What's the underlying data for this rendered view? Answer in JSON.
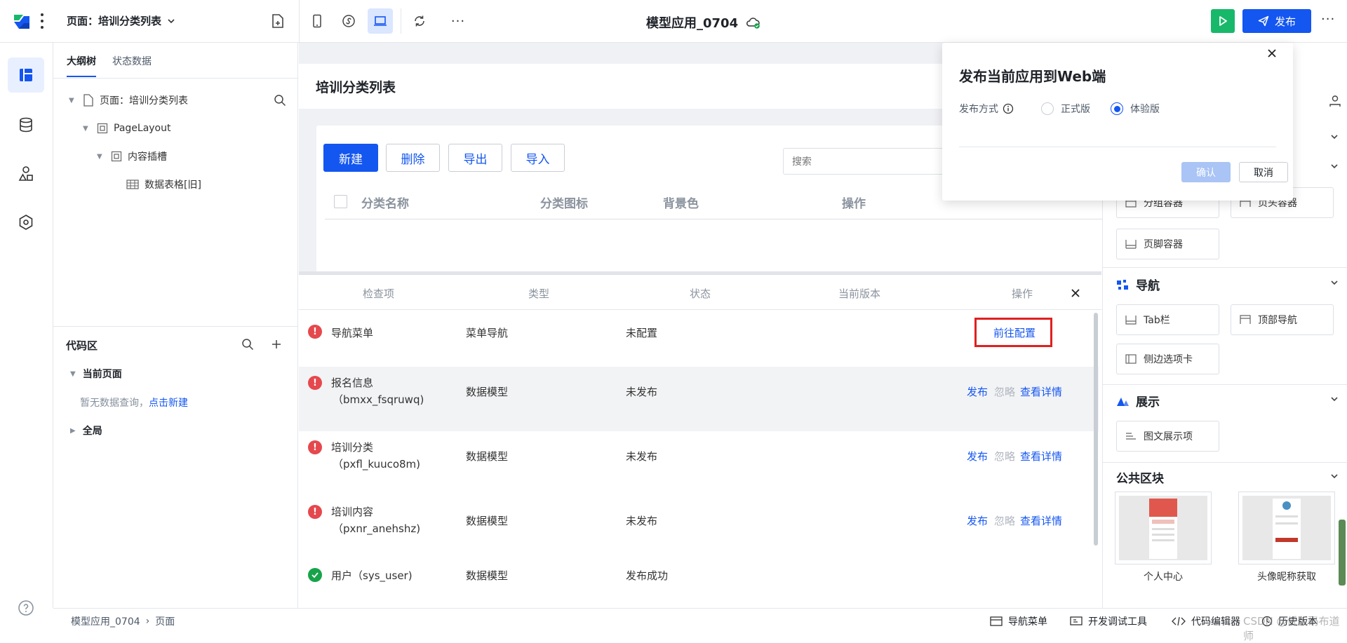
{
  "topbar": {
    "page_selector": "页面：培训分类列表",
    "app_title": "模型应用_0704",
    "publish_label": "发布"
  },
  "left_panel": {
    "tabs": [
      "大纲树",
      "状态数据"
    ],
    "tree": [
      {
        "label": "页面：培训分类列表"
      },
      {
        "label": "PageLayout"
      },
      {
        "label": "内容插槽"
      },
      {
        "label": "数据表格[旧]"
      }
    ],
    "code_area": {
      "title": "代码区",
      "current_page": "当前页面",
      "empty_text": "暂无数据查询，",
      "create_link": "点击新建",
      "global": "全局"
    }
  },
  "canvas": {
    "page_title": "培训分类列表",
    "buttons": {
      "new": "新建",
      "delete": "删除",
      "export": "导出",
      "import": "导入"
    },
    "search_placeholder": "搜索",
    "columns": [
      "分类名称",
      "分类图标",
      "背景色",
      "操作"
    ]
  },
  "check_panel": {
    "columns": [
      "检查项",
      "类型",
      "状态",
      "当前版本",
      "操作"
    ],
    "rows": [
      {
        "status_icon": "error",
        "name": "导航菜单",
        "code": "",
        "type": "菜单导航",
        "state": "未配置",
        "actions": {
          "goto": "前往配置"
        }
      },
      {
        "status_icon": "error",
        "name": "报名信息",
        "code": "（bmxx_fsqruwq)",
        "type": "数据模型",
        "state": "未发布",
        "actions": {
          "publish": "发布",
          "ignore": "忽略",
          "detail": "查看详情"
        }
      },
      {
        "status_icon": "error",
        "name": "培训分类",
        "code": "（pxfl_kuuco8m)",
        "type": "数据模型",
        "state": "未发布",
        "actions": {
          "publish": "发布",
          "ignore": "忽略",
          "detail": "查看详情"
        }
      },
      {
        "status_icon": "error",
        "name": "培训内容",
        "code": "（pxnr_anehshz)",
        "type": "数据模型",
        "state": "未发布",
        "actions": {
          "publish": "发布",
          "ignore": "忽略",
          "detail": "查看详情"
        }
      },
      {
        "status_icon": "success",
        "name": "用户（sys_user)",
        "code": "",
        "type": "数据模型",
        "state": "发布成功",
        "actions": {}
      }
    ]
  },
  "dialog": {
    "title": "发布当前应用到Web端",
    "method_label": "发布方式",
    "options": [
      "正式版",
      "体验版"
    ],
    "selected": "体验版",
    "confirm": "确认",
    "cancel": "取消"
  },
  "right_panel": {
    "layout_items": [
      "分组容器",
      "页头容器",
      "页脚容器"
    ],
    "nav_title": "导航",
    "nav_items": [
      "Tab栏",
      "顶部导航",
      "侧边选项卡"
    ],
    "display_title": "展示",
    "display_items": [
      "图文展示项"
    ],
    "public_title": "公共区块",
    "public_cards": [
      "个人中心",
      "头像昵称获取"
    ]
  },
  "statusbar": {
    "breadcrumb": [
      "模型应用_0704",
      "页面"
    ],
    "tools": [
      "导航菜单",
      "开发调试工具",
      "代码编辑器",
      "历史版本"
    ],
    "watermark": "CSDN @低代码布道师"
  },
  "colors": {
    "accent": "#1456f0",
    "success": "#17a34a",
    "error": "#e5484d",
    "highlight_box": "#e02020"
  }
}
